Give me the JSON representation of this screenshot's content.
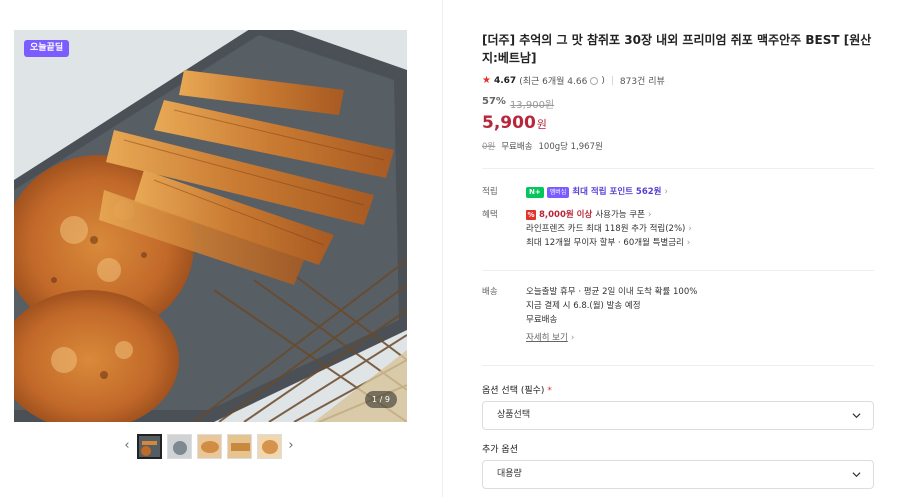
{
  "gallery": {
    "badge": "오늘끝딜",
    "counter": "1 / 9",
    "prev_arrow": "‹",
    "next_arrow": "›"
  },
  "product": {
    "title": "[더주] 추억의 그 맛 참쥐포 30장 내외 프리미엄 쥐포 맥주안주 BEST [원산지:베트남]",
    "rating": "4.67",
    "recent_rating": "(최근 6개월 4.66",
    "review_count": "873건 리뷰",
    "discount_rate": "57%",
    "original_price": "13,900원",
    "sale_price": "5,900",
    "sale_unit": "원",
    "shipping_zero": "0원",
    "shipping_label": "무료배송",
    "unit_price": "100g당 1,967원"
  },
  "points": {
    "label": "적립",
    "npay": "N+",
    "member": "멤버십",
    "text": "최대 적립 포인트 562원"
  },
  "benefits": {
    "label": "혜택",
    "coupon_icon": "%",
    "coupon_amount": "8,000원 이상",
    "coupon_text": "사용가능 쿠폰",
    "card_text": "라인프렌즈 카드 최대 118원 추가 적립(2%)",
    "installment_text": "최대 12개월 무이자 할부 · 60개월 특별금리"
  },
  "delivery": {
    "label": "배송",
    "line1": "오늘출발 휴무 · 평균 2일 이내 도착 확률 100%",
    "line2": "지금 결제 시 6.8.(월) 발송 예정",
    "line3": "무료배송",
    "detail_link": "자세히 보기"
  },
  "options": {
    "required_label": "옵션 선택 (필수)",
    "required_mark": "*",
    "required_value": "상품선택",
    "extra_label": "추가 옵션",
    "extra_value": "대용량"
  },
  "colors": {
    "accent_red": "#b8263a",
    "badge_purple": "#7a5cff",
    "npay_green": "#03c75a"
  }
}
